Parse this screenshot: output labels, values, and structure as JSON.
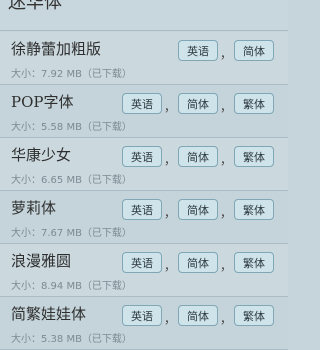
{
  "header": {
    "partial_title": "迷华体"
  },
  "fonts": [
    {
      "name": "徐静蕾加粗版",
      "size": "大小：7.92 MB（已下载）",
      "buttons": [
        "英语",
        "简体"
      ]
    },
    {
      "name": "POP字体",
      "size": "大小：5.58 MB（已下载）",
      "buttons": [
        "英语",
        "简体",
        "繁体"
      ]
    },
    {
      "name": "华康少女",
      "size": "大小：6.65 MB（已下载）",
      "buttons": [
        "英语",
        "简体",
        "繁体"
      ]
    },
    {
      "name": "萝莉体",
      "size": "大小：7.67 MB（已下载）",
      "buttons": [
        "英语",
        "简体",
        "繁体"
      ]
    },
    {
      "name": "浪漫雅圆",
      "size": "大小：8.94 MB（已下载）",
      "buttons": [
        "英语",
        "简体",
        "繁体"
      ]
    },
    {
      "name": "简繁娃娃体",
      "size": "大小：5.38 MB（已下载）",
      "buttons": [
        "英语",
        "简体",
        "繁体"
      ]
    }
  ],
  "separator": "，"
}
